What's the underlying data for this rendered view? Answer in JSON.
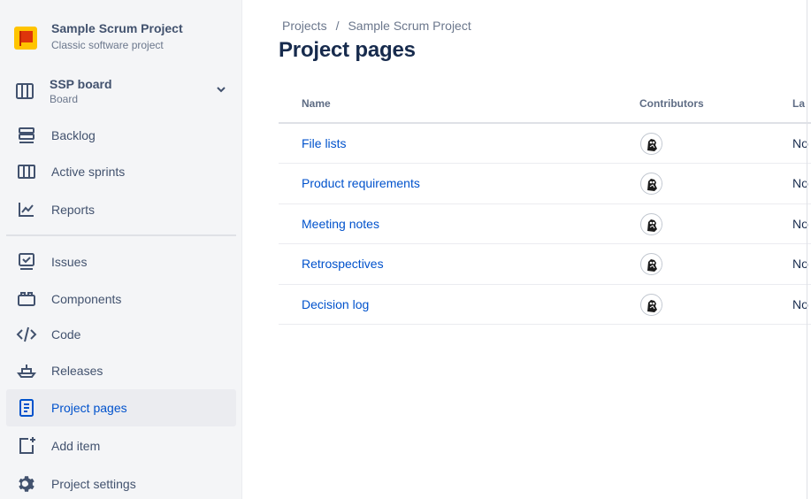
{
  "sidebar": {
    "project": {
      "name": "Sample Scrum Project",
      "type": "Classic software project",
      "avatar_color": "#ffc400"
    },
    "board": {
      "name": "SSP board",
      "sub": "Board"
    },
    "items": [
      {
        "label": "Backlog",
        "icon": "backlog-icon"
      },
      {
        "label": "Active sprints",
        "icon": "active-sprints-icon"
      },
      {
        "label": "Reports",
        "icon": "reports-icon"
      },
      {
        "label": "Issues",
        "icon": "issues-icon"
      },
      {
        "label": "Components",
        "icon": "components-icon"
      },
      {
        "label": "Code",
        "icon": "code-icon"
      },
      {
        "label": "Releases",
        "icon": "releases-icon"
      },
      {
        "label": "Project pages",
        "icon": "project-pages-icon",
        "active": true
      },
      {
        "label": "Add item",
        "icon": "add-item-icon"
      },
      {
        "label": "Project settings",
        "icon": "gear-icon"
      }
    ]
  },
  "main": {
    "breadcrumb": [
      "Projects",
      "Sample Scrum Project"
    ],
    "breadcrumb_sep": "/",
    "title": "Project pages",
    "table": {
      "headers": [
        "Name",
        "Contributors",
        "La"
      ],
      "rows": [
        {
          "name": "File lists",
          "last": "No"
        },
        {
          "name": "Product requirements",
          "last": "No"
        },
        {
          "name": "Meeting notes",
          "last": "No"
        },
        {
          "name": "Retrospectives",
          "last": "No"
        },
        {
          "name": "Decision log",
          "last": "No"
        }
      ]
    }
  },
  "colors": {
    "link": "#0052cc",
    "sidebar_bg": "#f4f5f7",
    "active_bg": "#ebecf0",
    "text": "#42526e"
  }
}
